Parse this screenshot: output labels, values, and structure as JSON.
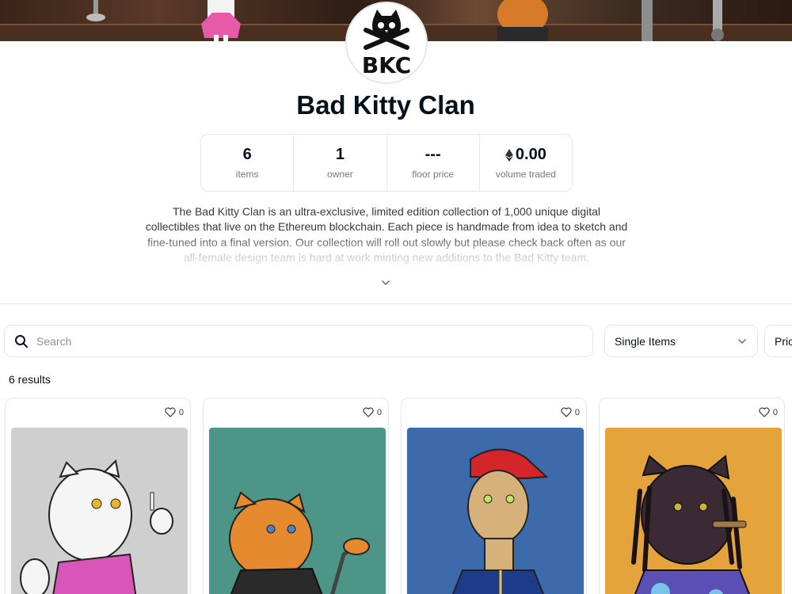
{
  "collection": {
    "logo_text": "BKC",
    "title": "Bad Kitty Clan",
    "description": "The Bad Kitty Clan is an ultra-exclusive, limited edition collection of 1,000 unique digital collectibles that live on the Ethereum blockchain. Each piece is handmade from idea to sketch and fine-tuned into a final version. Our collection will roll out slowly but please check back often as our all-female design team is hard at work minting new additions to the Bad Kitty team."
  },
  "stats": [
    {
      "value": "6",
      "label": "items"
    },
    {
      "value": "1",
      "label": "owner"
    },
    {
      "value": "---",
      "label": "floor price"
    },
    {
      "value": "0.00",
      "label": "volume traded",
      "icon": "ethereum-icon"
    }
  ],
  "filters": {
    "search_placeholder": "Search",
    "item_type": "Single Items",
    "sort": "Price"
  },
  "results_label": "6 results",
  "cards": [
    {
      "likes": "0",
      "background": "#cfcfcf"
    },
    {
      "likes": "0",
      "background": "#4d9587"
    },
    {
      "likes": "0",
      "background": "#3c6aaa"
    },
    {
      "likes": "0",
      "background": "#e4a43b"
    }
  ],
  "colors": {
    "text": "#04111d",
    "muted": "#707a83",
    "border": "#e5e8eb"
  }
}
